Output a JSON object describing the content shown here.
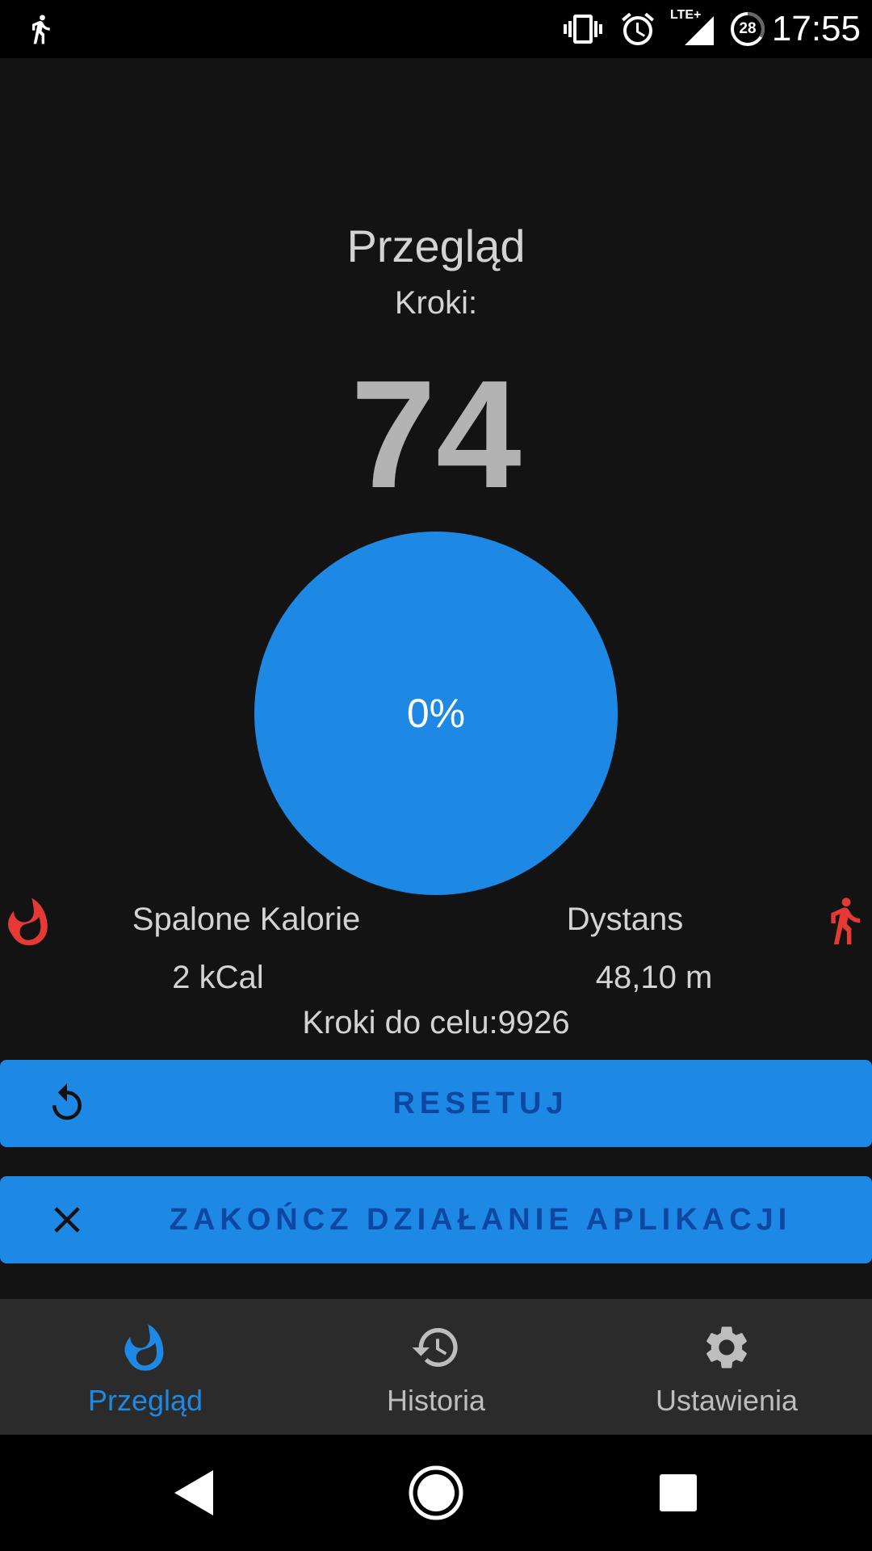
{
  "status_bar": {
    "time": "17:55",
    "notification_icon": "walking-person-icon",
    "icons": [
      "vibrate-icon",
      "alarm-icon",
      "lte-signal-icon",
      "battery-saver-icon"
    ],
    "network_label": "LTE+",
    "battery_level": "28"
  },
  "overview": {
    "title": "Przegląd",
    "steps_label": "Kroki:",
    "steps_value": "74",
    "progress_text": "0%",
    "progress_fraction": 0.0
  },
  "stats": {
    "calories": {
      "label": "Spalone Kalorie",
      "value": "2 kCal",
      "icon": "flame-icon"
    },
    "distance": {
      "label": "Dystans",
      "value": "48,10 m",
      "icon": "walking-person-icon"
    },
    "goal_remaining": "Kroki do celu:9926"
  },
  "buttons": {
    "reset": {
      "label": "RESETUJ",
      "icon": "reset-icon"
    },
    "exit": {
      "label": "ZAKOŃCZ DZIAŁANIE APLIKACJI",
      "icon": "close-icon"
    }
  },
  "bottom_nav": {
    "items": [
      {
        "label": "Przegląd",
        "icon": "flame-icon",
        "active": true
      },
      {
        "label": "Historia",
        "icon": "history-icon",
        "active": false
      },
      {
        "label": "Ustawienia",
        "icon": "gear-icon",
        "active": false
      }
    ]
  },
  "colors": {
    "accent": "#1e88e5",
    "background": "#131313",
    "nav_background": "#2b2b2b",
    "text": "#d3d3d3",
    "warning_red": "#e53935",
    "button_text": "#0d47a1"
  }
}
